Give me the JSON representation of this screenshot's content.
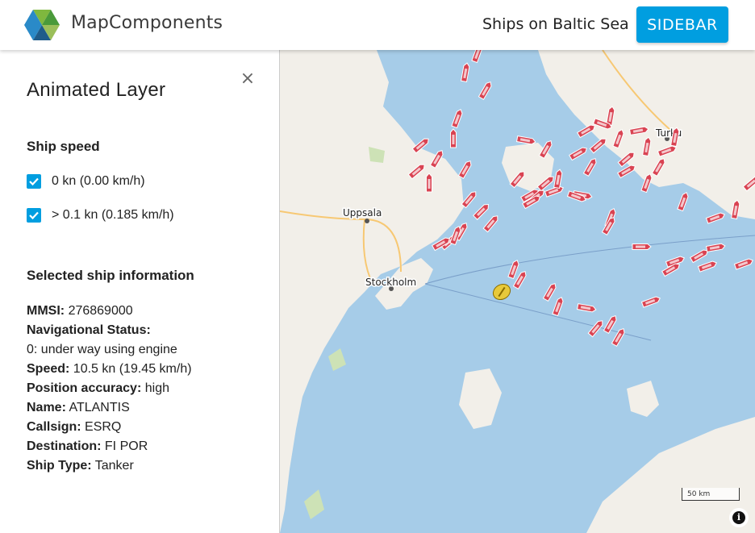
{
  "header": {
    "brand": "MapComponents",
    "app_title": "Ships on Baltic Sea",
    "sidebar_button": "SIDEBAR",
    "accent_color": "#009ee0"
  },
  "panel": {
    "title": "Animated Layer",
    "close_icon": "×",
    "speed_section": {
      "heading": "Ship speed",
      "options": [
        {
          "label": "0 kn (0.00 km/h)",
          "checked": true
        },
        {
          "label": "> 0.1 kn (0.185 km/h)",
          "checked": true
        }
      ]
    },
    "info_section": {
      "heading": "Selected ship information",
      "mmsi_label": "MMSI:",
      "mmsi_value": "276869000",
      "nav_status_label": "Navigational Status:",
      "nav_status_value": "0: under way using engine",
      "speed_label": "Speed:",
      "speed_value": "10.5 kn (19.45 km/h)",
      "position_accuracy_label": "Position accuracy:",
      "position_accuracy_value": "high",
      "name_label": "Name:",
      "name_value": "ATLANTIS",
      "callsign_label": "Callsign:",
      "callsign_value": "ESRQ",
      "destination_label": "Destination:",
      "destination_value": "FI POR",
      "ship_type_label": "Ship Type:",
      "ship_type_value": "Tanker"
    }
  },
  "map": {
    "places": {
      "turku": "Turku",
      "uppsala": "Uppsala",
      "stockholm": "Stockholm"
    },
    "scale_label": "50 km",
    "attribution_icon": "i",
    "water_color": "#a6cce8",
    "land_color": "#f2efe9",
    "ship_color": "#d94352",
    "selected_ship_color": "#e8c93a"
  }
}
